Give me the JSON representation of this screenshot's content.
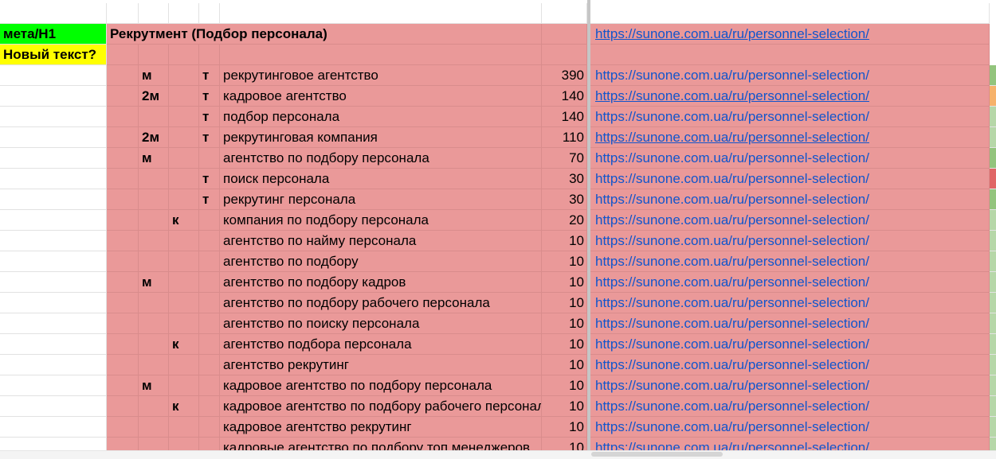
{
  "meta_label": "мета/H1",
  "new_text_label": "Новый текст?",
  "title": "Рекрутмент (Подбор персонала)",
  "title_url": "https://sunone.com.ua/ru/personnel-selection/",
  "colors": {
    "pink": "#ea9999",
    "green": "#00ff00",
    "yellow": "#ffff00",
    "link": "#1155cc",
    "strip_green": "#93c47d",
    "strip_orange": "#f6b26b",
    "strip_light_green": "#b6d7a8",
    "strip_red": "#e06666"
  },
  "rows": [
    {
      "m": "м",
      "k": "",
      "t": "т",
      "keyword": "рекрутинговое агентство",
      "volume": "390",
      "url": "https://sunone.com.ua/ru/personnel-selection/",
      "underline": false,
      "strip": "#93c47d"
    },
    {
      "m": "2м",
      "k": "",
      "t": "т",
      "keyword": "кадровое агентство",
      "volume": "140",
      "url": "https://sunone.com.ua/ru/personnel-selection/",
      "underline": true,
      "strip": "#f6b26b"
    },
    {
      "m": "",
      "k": "",
      "t": "т",
      "keyword": "подбор персонала",
      "volume": "140",
      "url": "https://sunone.com.ua/ru/personnel-selection/",
      "underline": false,
      "strip": "#b6d7a8"
    },
    {
      "m": "2м",
      "k": "",
      "t": "т",
      "keyword": "рекрутинговая компания",
      "volume": "110",
      "url": "https://sunone.com.ua/ru/personnel-selection/",
      "underline": true,
      "strip": "#b6d7a8"
    },
    {
      "m": "м",
      "k": "",
      "t": "",
      "keyword": "агентство по подбору персонала",
      "volume": "70",
      "url": "https://sunone.com.ua/ru/personnel-selection/",
      "underline": false,
      "strip": "#93c47d"
    },
    {
      "m": "",
      "k": "",
      "t": "т",
      "keyword": "поиск персонала",
      "volume": "30",
      "url": "https://sunone.com.ua/ru/personnel-selection/",
      "underline": false,
      "strip": "#e06666"
    },
    {
      "m": "",
      "k": "",
      "t": "т",
      "keyword": "рекрутинг персонала",
      "volume": "30",
      "url": "https://sunone.com.ua/ru/personnel-selection/",
      "underline": false,
      "strip": "#93c47d"
    },
    {
      "m": "",
      "k": "к",
      "t": "",
      "keyword": "компания по подбору персонала",
      "volume": "20",
      "url": "https://sunone.com.ua/ru/personnel-selection/",
      "underline": false,
      "strip": "#b6d7a8"
    },
    {
      "m": "",
      "k": "",
      "t": "",
      "keyword": "агентство по найму персонала",
      "volume": "10",
      "url": "https://sunone.com.ua/ru/personnel-selection/",
      "underline": false,
      "strip": "#b6d7a8"
    },
    {
      "m": "",
      "k": "",
      "t": "",
      "keyword": "агентство по подбору",
      "volume": "10",
      "url": "https://sunone.com.ua/ru/personnel-selection/",
      "underline": false,
      "strip": "#b6d7a8"
    },
    {
      "m": "м",
      "k": "",
      "t": "",
      "keyword": "агентство по подбору кадров",
      "volume": "10",
      "url": "https://sunone.com.ua/ru/personnel-selection/",
      "underline": false,
      "strip": "#b6d7a8"
    },
    {
      "m": "",
      "k": "",
      "t": "",
      "keyword": "агентство по подбору рабочего персонала",
      "volume": "10",
      "url": "https://sunone.com.ua/ru/personnel-selection/",
      "underline": false,
      "strip": "#b6d7a8"
    },
    {
      "m": "",
      "k": "",
      "t": "",
      "keyword": "агентство по поиску персонала",
      "volume": "10",
      "url": "https://sunone.com.ua/ru/personnel-selection/",
      "underline": false,
      "strip": "#b6d7a8"
    },
    {
      "m": "",
      "k": "к",
      "t": "",
      "keyword": "агентство подбора персонала",
      "volume": "10",
      "url": "https://sunone.com.ua/ru/personnel-selection/",
      "underline": false,
      "strip": "#b6d7a8"
    },
    {
      "m": "",
      "k": "",
      "t": "",
      "keyword": "агентство рекрутинг",
      "volume": "10",
      "url": "https://sunone.com.ua/ru/personnel-selection/",
      "underline": false,
      "strip": "#b6d7a8"
    },
    {
      "m": "м",
      "k": "",
      "t": "",
      "keyword": "кадровое агентство по подбору персонала",
      "volume": "10",
      "url": "https://sunone.com.ua/ru/personnel-selection/",
      "underline": false,
      "strip": "#b6d7a8"
    },
    {
      "m": "",
      "k": "к",
      "t": "",
      "keyword": "кадровое агентство по подбору рабочего персонала",
      "volume": "10",
      "url": "https://sunone.com.ua/ru/personnel-selection/",
      "underline": false,
      "strip": "#b6d7a8"
    },
    {
      "m": "",
      "k": "",
      "t": "",
      "keyword": "кадровое агентство рекрутинг",
      "volume": "10",
      "url": "https://sunone.com.ua/ru/personnel-selection/",
      "underline": false,
      "strip": "#b6d7a8"
    },
    {
      "m": "",
      "k": "",
      "t": "",
      "keyword": "кадровые агентство по подбору топ менеджеров",
      "volume": "10",
      "url": "https://sunone.com.ua/ru/personnel-selection/",
      "underline": false,
      "strip": "#b6d7a8"
    }
  ]
}
